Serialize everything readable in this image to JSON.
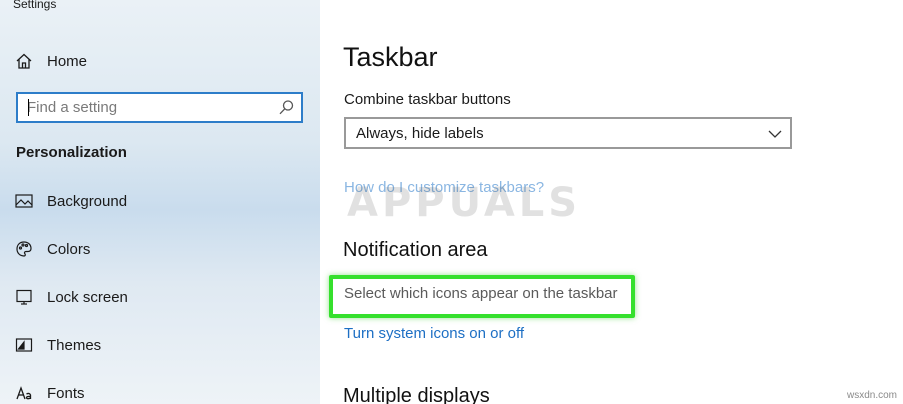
{
  "app": {
    "title": "Settings"
  },
  "sidebar": {
    "home_label": "Home",
    "search": {
      "placeholder": "Find a setting",
      "value": ""
    },
    "section_heading": "Personalization",
    "items": [
      {
        "label": "Background",
        "icon": "image-icon"
      },
      {
        "label": "Colors",
        "icon": "palette-icon"
      },
      {
        "label": "Lock screen",
        "icon": "lock-screen-icon"
      },
      {
        "label": "Themes",
        "icon": "themes-icon"
      },
      {
        "label": "Fonts",
        "icon": "fonts-icon"
      }
    ]
  },
  "main": {
    "title": "Taskbar",
    "combine_label": "Combine taskbar buttons",
    "combine_value": "Always, hide labels",
    "customize_link": "How do I customize taskbars?",
    "notification_heading": "Notification area",
    "select_icons_text": "Select which icons appear on the taskbar",
    "system_icons_link": "Turn system icons on or off",
    "multiple_displays_heading": "Multiple displays"
  },
  "overlay": {
    "watermark": "APPUALS",
    "credit": "wsxdn.com"
  },
  "colors": {
    "accent": "#1d6fc4",
    "search_border": "#2d7dc9",
    "highlight": "#35e02d"
  }
}
